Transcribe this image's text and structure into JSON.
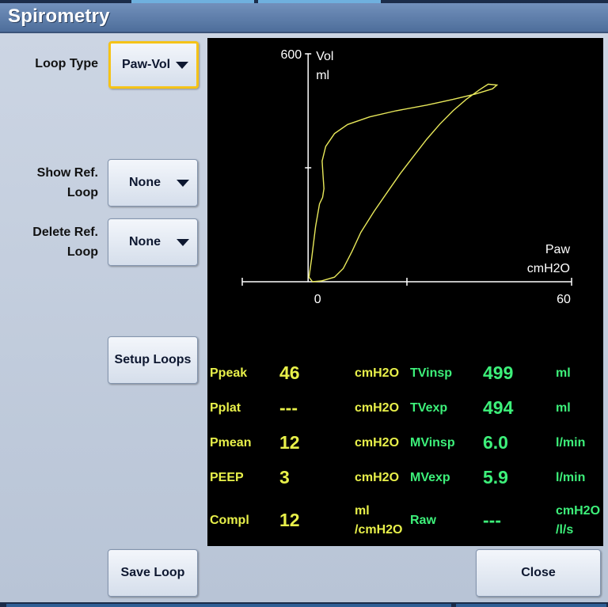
{
  "window": {
    "title": "Spirometry"
  },
  "controls": {
    "loop_type_label": "Loop Type",
    "loop_type_value": "Paw-Vol",
    "show_ref_label_1": "Show Ref.",
    "show_ref_label_2": "Loop",
    "show_ref_value": "None",
    "delete_ref_label_1": "Delete Ref.",
    "delete_ref_label_2": "Loop",
    "delete_ref_value": "None",
    "setup_loops": "Setup Loops",
    "save_loop": "Save Loop",
    "close": "Close"
  },
  "chart_data": {
    "type": "line",
    "title": "",
    "y_axis": {
      "label_1": "Vol",
      "label_2": "ml",
      "max_label": "600",
      "range": [
        0,
        600
      ]
    },
    "x_axis": {
      "label_1": "Paw",
      "label_2": "cmH2O",
      "min_label": "0",
      "max_label": "60",
      "range": [
        -15,
        60
      ]
    },
    "loop_color": "#e8e85a",
    "series": [
      {
        "points": [
          [
            1,
            0
          ],
          [
            3,
            2
          ],
          [
            6,
            12
          ],
          [
            8,
            35
          ],
          [
            10,
            80
          ],
          [
            12,
            130
          ],
          [
            15,
            185
          ],
          [
            18,
            235
          ],
          [
            21,
            285
          ],
          [
            24,
            330
          ],
          [
            27,
            375
          ],
          [
            30,
            415
          ],
          [
            33,
            450
          ],
          [
            36,
            480
          ],
          [
            39,
            505
          ],
          [
            41,
            520
          ],
          [
            43,
            518
          ],
          [
            42,
            508
          ],
          [
            38,
            494
          ],
          [
            33,
            480
          ],
          [
            27,
            465
          ],
          [
            20,
            450
          ],
          [
            14,
            434
          ],
          [
            9,
            414
          ],
          [
            6,
            390
          ],
          [
            4,
            356
          ],
          [
            3.2,
            318
          ],
          [
            3.4,
            278
          ],
          [
            3.6,
            245
          ],
          [
            3.3,
            222
          ],
          [
            2.6,
            205
          ],
          [
            1.7,
            145
          ],
          [
            0.8,
            60
          ],
          [
            0.2,
            12
          ],
          [
            1,
            0
          ]
        ]
      }
    ]
  },
  "values": {
    "rows": [
      {
        "name": "Ppeak",
        "value": "46",
        "unit": "cmH2O",
        "name2": "TVinsp",
        "value2": "499",
        "unit2": "ml"
      },
      {
        "name": "Pplat",
        "value": "---",
        "unit": "cmH2O",
        "name2": "TVexp",
        "value2": "494",
        "unit2": "ml"
      },
      {
        "name": "Pmean",
        "value": "12",
        "unit": "cmH2O",
        "name2": "MVinsp",
        "value2": "6.0",
        "unit2": "l/min"
      },
      {
        "name": "PEEP",
        "value": "3",
        "unit": "cmH2O",
        "name2": "MVexp",
        "value2": "5.9",
        "unit2": "l/min"
      }
    ],
    "compl": {
      "name": "Compl",
      "value": "12",
      "unit_1": "ml",
      "unit_2": "/cmH2O"
    },
    "raw": {
      "name": "Raw",
      "value": "---",
      "unit_1": "cmH2O",
      "unit_2": "/l/s"
    }
  }
}
